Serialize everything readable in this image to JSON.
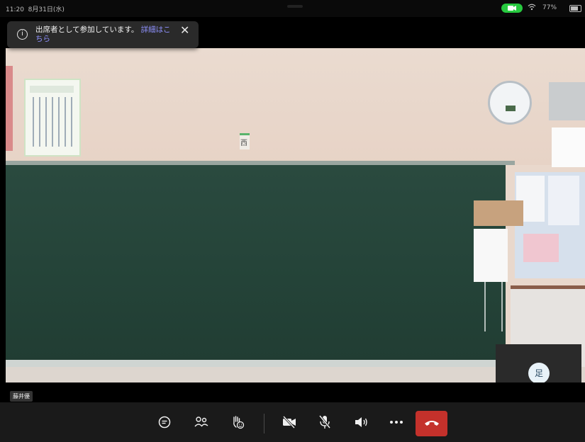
{
  "status_bar": {
    "time": "11:20",
    "date": "8月31日(水)",
    "battery": "77%"
  },
  "notification": {
    "message": "出席者として参加しています。",
    "link": "詳細はこちら"
  },
  "video": {
    "participant_name": "藤井優",
    "self_avatar_initial": "足",
    "board_tag": "西"
  },
  "toolbar": {
    "buttons": [
      {
        "icon": "chat-icon"
      },
      {
        "icon": "participants-icon"
      },
      {
        "icon": "raise-hand-icon"
      },
      {
        "icon": "camera-off-icon"
      },
      {
        "icon": "mic-off-icon"
      },
      {
        "icon": "speaker-icon"
      },
      {
        "icon": "more-icon"
      },
      {
        "icon": "hang-up-icon"
      }
    ]
  },
  "colors": {
    "hangup": "#c4312b",
    "link": "#8f92ff",
    "camera_pill": "#27c93f"
  }
}
